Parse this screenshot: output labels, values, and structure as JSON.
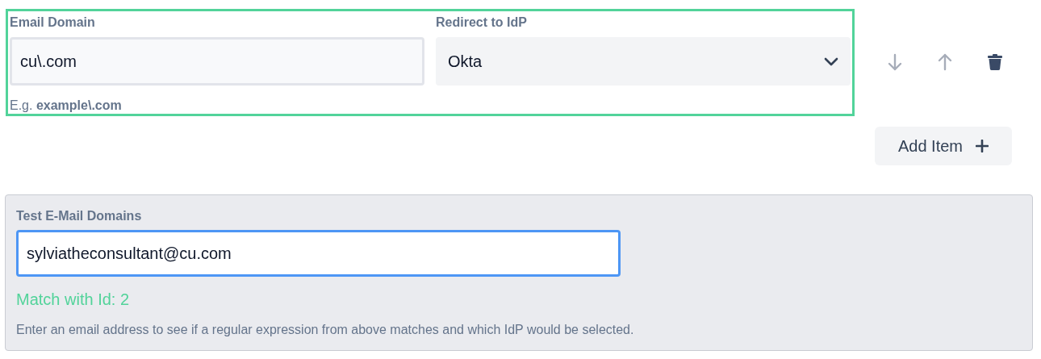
{
  "mapping_row": {
    "highlighted": true,
    "email_domain": {
      "label": "Email Domain",
      "value": "cu\\.com",
      "hint": "E.g. **example\\.com**"
    },
    "redirect": {
      "label": "Redirect to IdP",
      "value": "Okta"
    }
  },
  "row_actions": [
    {
      "kind": "move-down",
      "disabled": true
    },
    {
      "kind": "move-up",
      "disabled": true
    },
    {
      "kind": "delete",
      "disabled": false
    }
  ],
  "add_item_button": "Add Item",
  "test_panel": {
    "label": "Test E-Mail Domains",
    "value": "sylviatheconsultant@cu.com",
    "focused": true,
    "result": "Match with Id: 2",
    "matched": true,
    "help": "Enter an email address to see if a regular expression from above matches and which IdP would be selected."
  }
}
